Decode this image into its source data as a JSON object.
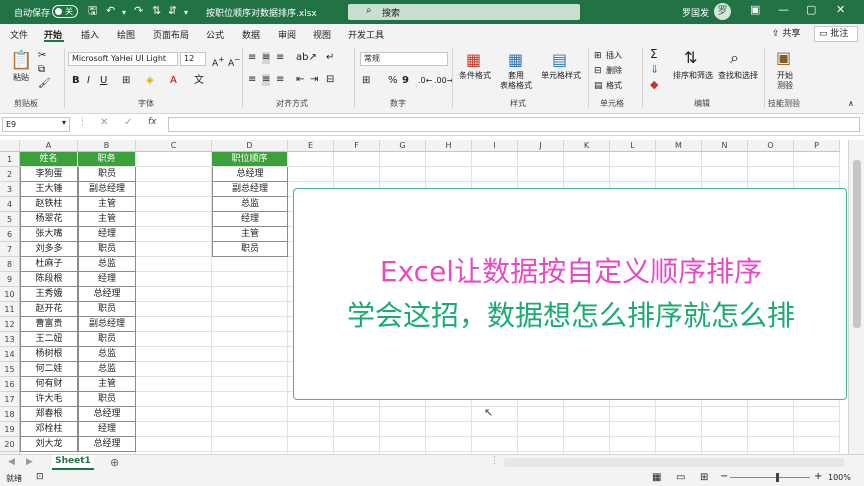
{
  "titlebar": {
    "autosave_label": "自动保存",
    "autosave_state": "关",
    "filename": "按职位顺序对数据排序.xlsx",
    "search_placeholder": "搜索",
    "user_name": "罗国发",
    "avatar_initial": "罗"
  },
  "menu": {
    "tabs": [
      "文件",
      "开始",
      "插入",
      "绘图",
      "页面布局",
      "公式",
      "数据",
      "审阅",
      "视图",
      "开发工具"
    ],
    "active_tab": "开始",
    "share_label": "共享",
    "comment_label": "批注"
  },
  "ribbon": {
    "groups": {
      "clipboard": "剪贴板",
      "font": "字体",
      "alignment": "对齐方式",
      "number": "数字",
      "styles": "样式",
      "cells": "单元格",
      "editing": "编辑",
      "dev": "技能测验"
    },
    "paste_label": "粘贴",
    "font_name": "Microsoft YaHei UI Light",
    "font_size": "12",
    "number_format": "常规",
    "conditional_format": "条件格式",
    "format_as_table_l1": "套用",
    "format_as_table_l2": "表格格式",
    "cell_styles": "单元格样式",
    "insert": "插入",
    "delete": "删除",
    "format": "格式",
    "sort_filter": "排序和筛选",
    "find_select": "查找和选择",
    "start_l1": "开始",
    "start_l2": "测验"
  },
  "formula_bar": {
    "name_box": "E9",
    "formula": ""
  },
  "sheet": {
    "columns": [
      "A",
      "B",
      "C",
      "D",
      "E",
      "F",
      "G",
      "H",
      "I",
      "J",
      "K",
      "L",
      "M",
      "N",
      "O",
      "P"
    ],
    "rows": [
      "1",
      "2",
      "3",
      "4",
      "5",
      "6",
      "7",
      "8",
      "9",
      "10",
      "11",
      "12",
      "13",
      "14",
      "15",
      "16",
      "17",
      "18",
      "19",
      "20"
    ],
    "table_headers": [
      "姓名",
      "职务"
    ],
    "table_rows": [
      [
        "李狗蛋",
        "职员"
      ],
      [
        "王大锤",
        "副总经理"
      ],
      [
        "赵铁柱",
        "主管"
      ],
      [
        "杨翠花",
        "主管"
      ],
      [
        "张大嘴",
        "经理"
      ],
      [
        "刘多多",
        "职员"
      ],
      [
        "杜麻子",
        "总监"
      ],
      [
        "陈段根",
        "经理"
      ],
      [
        "王秀娥",
        "总经理"
      ],
      [
        "赵开花",
        "职员"
      ],
      [
        "曹富贵",
        "副总经理"
      ],
      [
        "王二妞",
        "职员"
      ],
      [
        "杨树根",
        "总监"
      ],
      [
        "何二娃",
        "总监"
      ],
      [
        "何有财",
        "主管"
      ],
      [
        "许大毛",
        "职员"
      ],
      [
        "郑春根",
        "总经理"
      ],
      [
        "邓栓柱",
        "经理"
      ],
      [
        "刘大龙",
        "总经理"
      ]
    ],
    "order_header": "职位顺序",
    "order_values": [
      "总经理",
      "副总经理",
      "总监",
      "经理",
      "主管",
      "职员"
    ]
  },
  "overlay": {
    "line1": "Excel让数据按自定义顺序排序",
    "line2": "学会这招，数据想怎么排序就怎么排"
  },
  "sheet_tabs": {
    "active": "Sheet1"
  },
  "status": {
    "ready": "就绪",
    "zoom": "100%"
  },
  "colors": {
    "excel_green": "#217346",
    "header_fill": "#3ca13c",
    "overlay_pink": "#e64ac6",
    "overlay_green": "#1aab72"
  }
}
